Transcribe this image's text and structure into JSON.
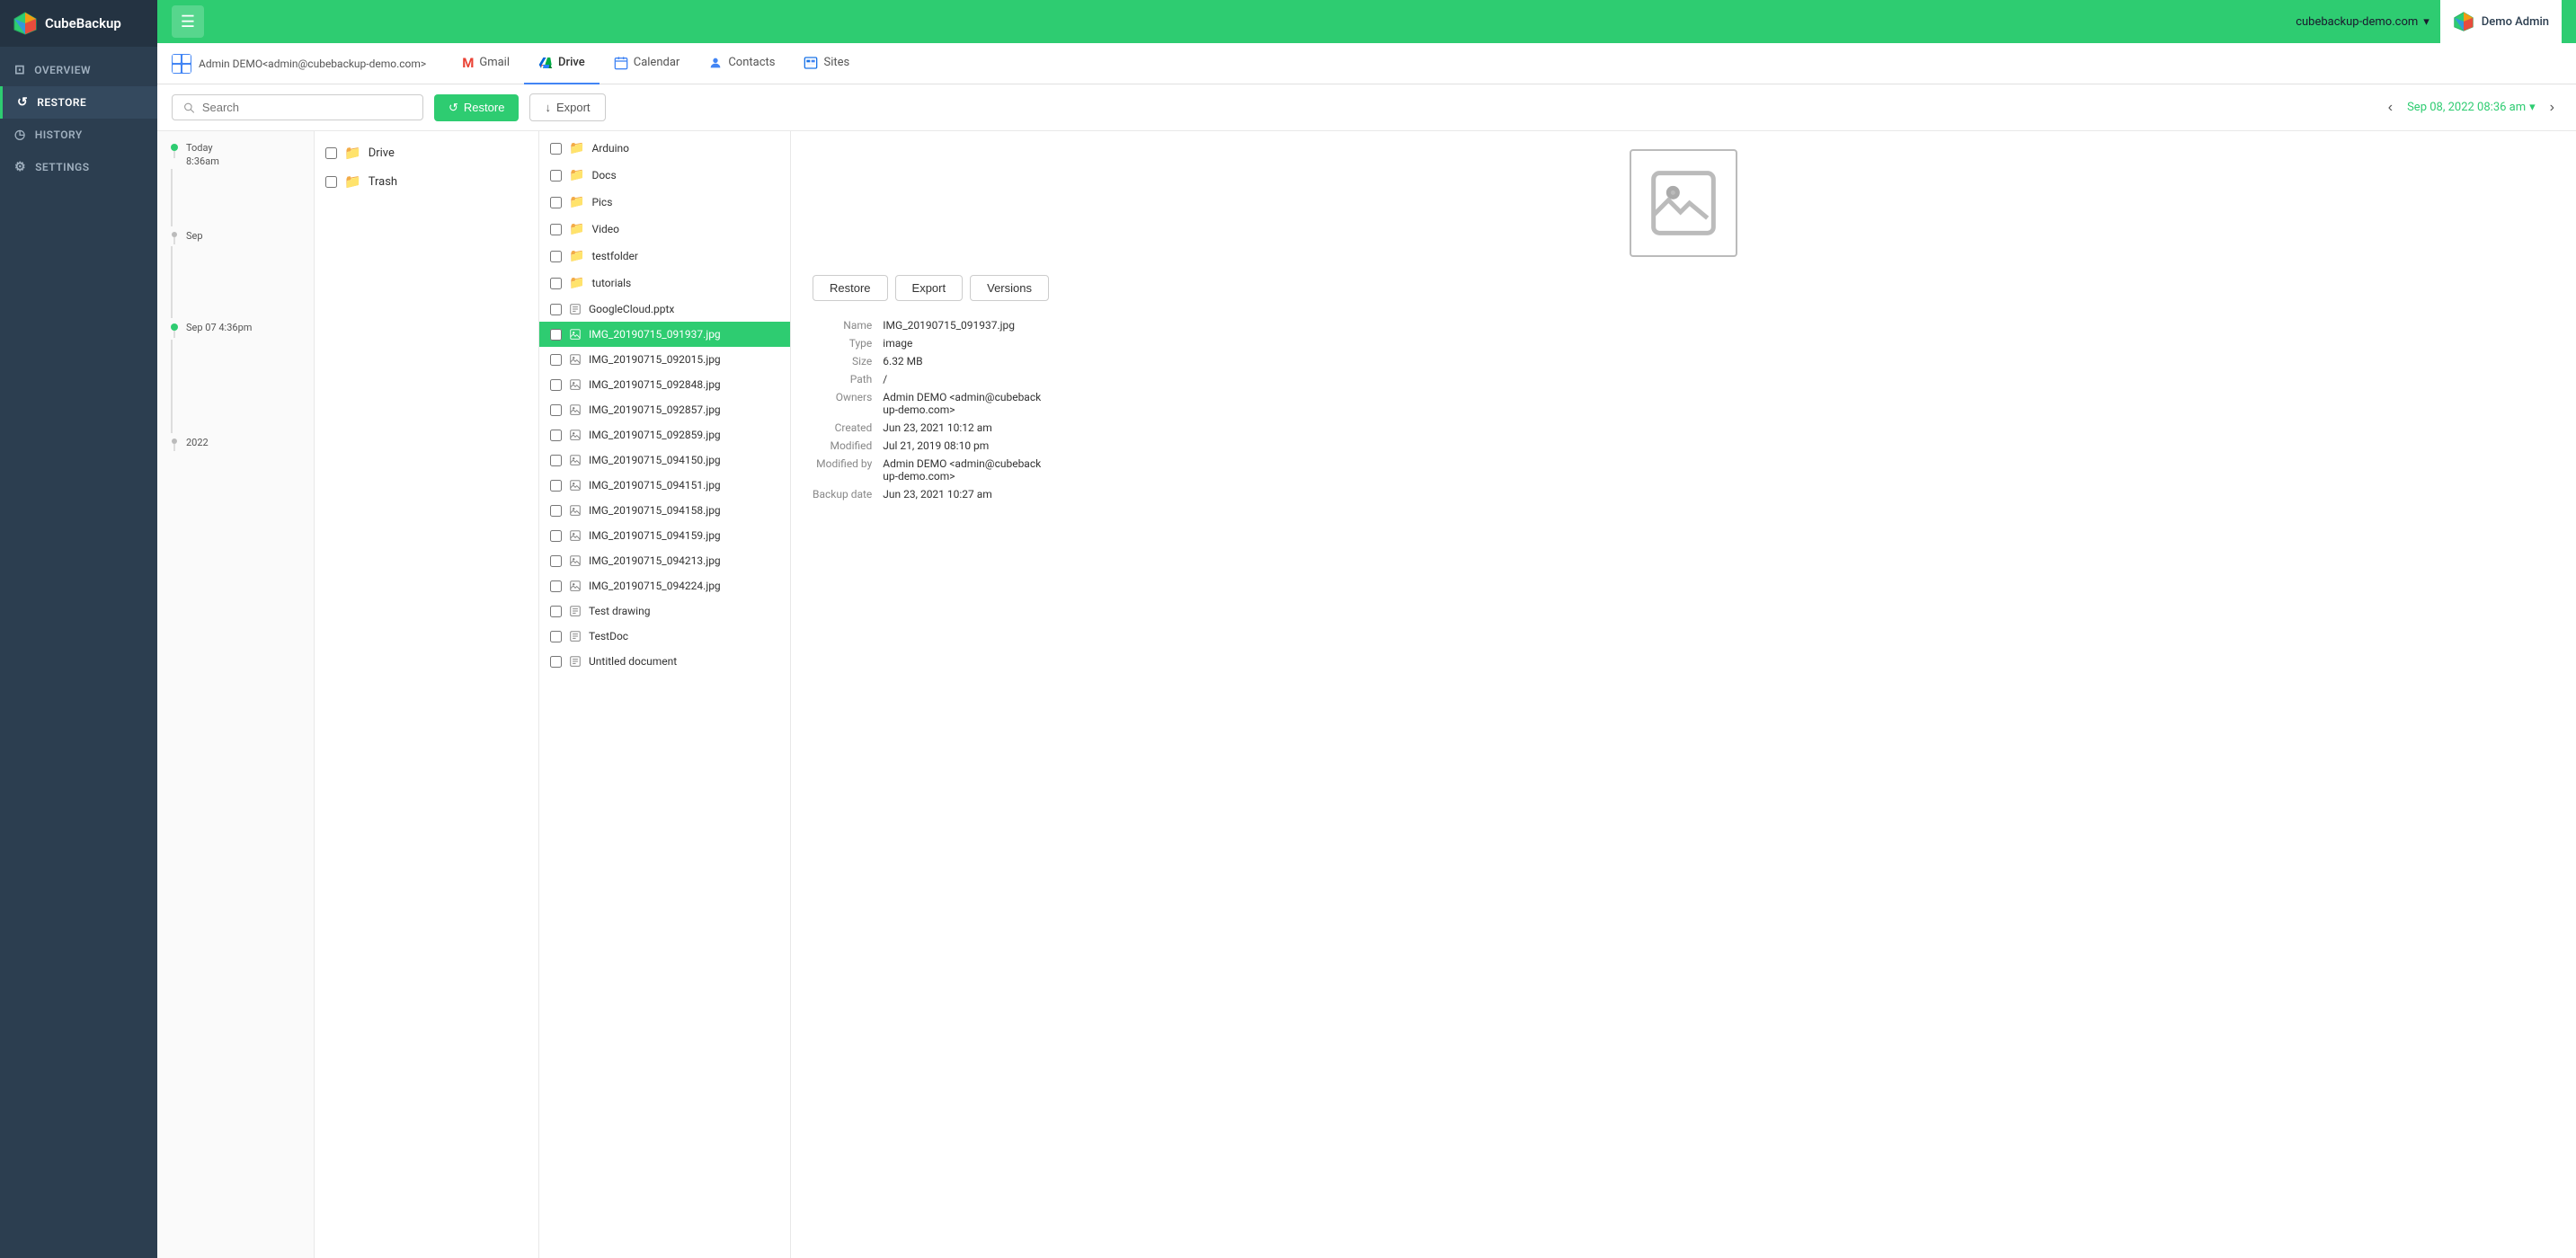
{
  "app": {
    "name": "CubeBackup",
    "domain": "cubebackup-demo.com",
    "admin": "Demo Admin"
  },
  "sidebar": {
    "items": [
      {
        "id": "overview",
        "label": "OVERVIEW",
        "icon": "⊡"
      },
      {
        "id": "restore",
        "label": "RESTORE",
        "icon": "↺",
        "active": true
      },
      {
        "id": "history",
        "label": "HISTORY",
        "icon": "◷"
      },
      {
        "id": "settings",
        "label": "SETTINGS",
        "icon": "⚙"
      }
    ]
  },
  "topbar": {
    "hamburger_label": "☰",
    "domain": "cubebackup-demo.com",
    "admin_name": "Demo Admin"
  },
  "user_tabs": {
    "user_email": "Admin DEMO<admin@cubebackup-demo.com>",
    "tabs": [
      {
        "id": "gmail",
        "label": "Gmail",
        "icon": "M"
      },
      {
        "id": "drive",
        "label": "Drive",
        "active": true
      },
      {
        "id": "calendar",
        "label": "Calendar"
      },
      {
        "id": "contacts",
        "label": "Contacts"
      },
      {
        "id": "sites",
        "label": "Sites"
      }
    ]
  },
  "toolbar": {
    "search_placeholder": "Search",
    "restore_label": "Restore",
    "export_label": "Export",
    "date": "Sep 08, 2022 08:36 am"
  },
  "timeline": {
    "sections": [
      {
        "label": "Today",
        "time": "8:36am"
      },
      {
        "label": "Sep"
      },
      {
        "label": "Sep 07 4:36pm"
      },
      {
        "label": "2022"
      }
    ]
  },
  "folders": [
    {
      "name": "Drive",
      "icon": "📁"
    },
    {
      "name": "Trash",
      "icon": "📁"
    }
  ],
  "files": [
    {
      "name": "Arduino",
      "icon": "📁",
      "type": "folder"
    },
    {
      "name": "Docs",
      "icon": "📁",
      "type": "folder"
    },
    {
      "name": "Pics",
      "icon": "📁",
      "type": "folder"
    },
    {
      "name": "Video",
      "icon": "📁",
      "type": "folder"
    },
    {
      "name": "testfolder",
      "icon": "📁",
      "type": "folder"
    },
    {
      "name": "tutorials",
      "icon": "📁",
      "type": "folder"
    },
    {
      "name": "GoogleCloud.pptx",
      "icon": "📄",
      "type": "file"
    },
    {
      "name": "IMG_20190715_091937.jpg",
      "icon": "🖼",
      "type": "file",
      "selected": true
    },
    {
      "name": "IMG_20190715_092015.jpg",
      "icon": "🖼",
      "type": "file"
    },
    {
      "name": "IMG_20190715_092848.jpg",
      "icon": "🖼",
      "type": "file"
    },
    {
      "name": "IMG_20190715_092857.jpg",
      "icon": "🖼",
      "type": "file"
    },
    {
      "name": "IMG_20190715_092859.jpg",
      "icon": "🖼",
      "type": "file"
    },
    {
      "name": "IMG_20190715_094150.jpg",
      "icon": "🖼",
      "type": "file"
    },
    {
      "name": "IMG_20190715_094151.jpg",
      "icon": "🖼",
      "type": "file"
    },
    {
      "name": "IMG_20190715_094158.jpg",
      "icon": "🖼",
      "type": "file"
    },
    {
      "name": "IMG_20190715_094159.jpg",
      "icon": "🖼",
      "type": "file"
    },
    {
      "name": "IMG_20190715_094213.jpg",
      "icon": "🖼",
      "type": "file"
    },
    {
      "name": "IMG_20190715_094224.jpg",
      "icon": "🖼",
      "type": "file"
    },
    {
      "name": "Test drawing",
      "icon": "📄",
      "type": "file"
    },
    {
      "name": "TestDoc",
      "icon": "📄",
      "type": "file"
    },
    {
      "name": "Untitled document",
      "icon": "📄",
      "type": "file"
    }
  ],
  "preview": {
    "restore_label": "Restore",
    "export_label": "Export",
    "versions_label": "Versions",
    "meta": {
      "name_label": "Name",
      "name_value": "IMG_20190715_091937.jpg",
      "type_label": "Type",
      "type_value": "image",
      "size_label": "Size",
      "size_value": "6.32 MB",
      "path_label": "Path",
      "path_value": "/",
      "owners_label": "Owners",
      "owners_value": "Admin DEMO <admin@cubeback\nup-demo.com>",
      "created_label": "Created",
      "created_value": "Jun 23, 2021 10:12 am",
      "modified_label": "Modified",
      "modified_value": "Jul 21, 2019 08:10 pm",
      "modified_by_label": "Modified by",
      "modified_by_value": "Admin DEMO <admin@cubeback\nup-demo.com>",
      "backup_date_label": "Backup date",
      "backup_date_value": "Jun 23, 2021 10:27 am"
    }
  }
}
